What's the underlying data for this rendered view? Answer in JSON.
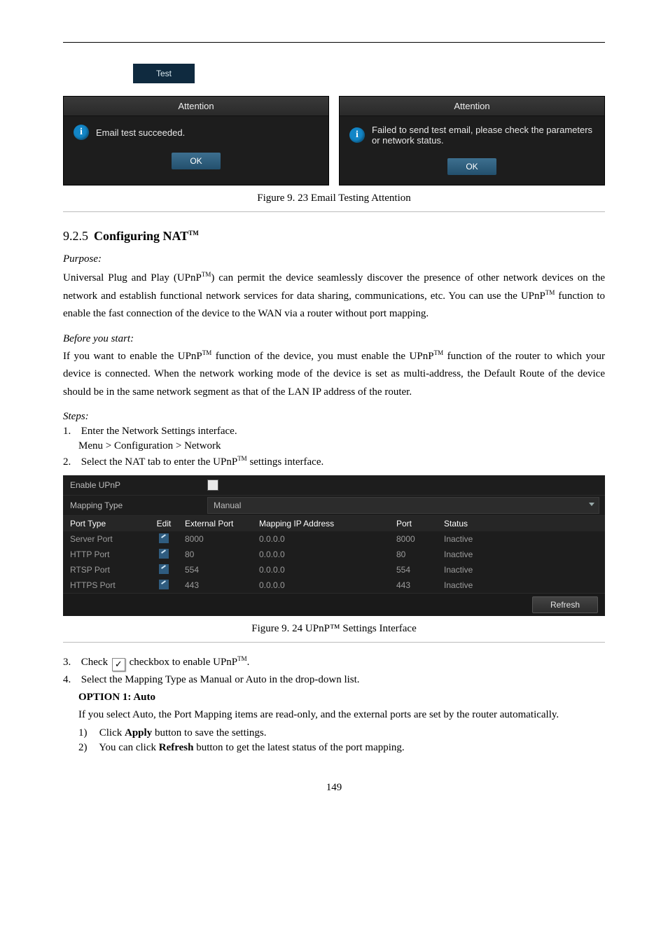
{
  "test_button": "Test",
  "dialog1": {
    "title": "Attention",
    "msg": "Email test succeeded.",
    "ok": "OK"
  },
  "dialog2": {
    "title": "Attention",
    "msg": "Failed to send test email, please check the parameters or network status.",
    "ok": "OK"
  },
  "figure23": "Figure 9. 23  Email Testing Attention",
  "heading": {
    "num": "9.2.5",
    "title_pre": "Configuring NAT",
    "tm": "TM"
  },
  "purpose_label": "Purpose:",
  "purpose_text_1": "Universal Plug and Play (UPnP",
  "purpose_text_2": ") can permit the device seamlessly discover the presence of other network devices on the network and establish functional network services for data sharing, communications, etc. You can use the UPnP",
  "purpose_text_3": " function to enable the fast connection of the device to the WAN via a router without port mapping.",
  "before_label": "Before you start:",
  "before_text_1": "If you want to enable the UPnP",
  "before_text_2": " function of the device, you must enable the UPnP",
  "before_text_3": " function of the router to which your device is connected. When the network working mode of the device is set as multi-address, the Default Route of the device should be in the same network segment as that of the LAN IP address of the router.",
  "steps_label": "Steps:",
  "step1_a": "1.",
  "step1_b": "Enter the Network Settings interface.",
  "step1_c": "Menu > Configuration > Network",
  "step2_a": "2.",
  "step2_b_1": "Select the NAT tab to enter the UPnP",
  "step2_b_2": " settings interface.",
  "upnp": {
    "enable_label": "Enable UPnP",
    "mapping_label": "Mapping Type",
    "mapping_value": "Manual",
    "headers": {
      "c1": "Port Type",
      "c2": "Edit",
      "c3": "External Port",
      "c4": "Mapping IP Address",
      "c5": "Port",
      "c6": "Status"
    },
    "rows": [
      {
        "c1": "Server Port",
        "c3": "8000",
        "c4": "0.0.0.0",
        "c5": "8000",
        "c6": "Inactive"
      },
      {
        "c1": "HTTP Port",
        "c3": "80",
        "c4": "0.0.0.0",
        "c5": "80",
        "c6": "Inactive"
      },
      {
        "c1": "RTSP Port",
        "c3": "554",
        "c4": "0.0.0.0",
        "c5": "554",
        "c6": "Inactive"
      },
      {
        "c1": "HTTPS Port",
        "c3": "443",
        "c4": "0.0.0.0",
        "c5": "443",
        "c6": "Inactive"
      }
    ],
    "refresh": "Refresh"
  },
  "figure24": "Figure 9. 24  UPnP™ Settings Interface",
  "step3_a": "3.",
  "step3_b": "Check",
  "step3_c": "checkbox to enable UPnP",
  "step3_d": ".",
  "check_mark": "✓",
  "step4_a": "4.",
  "step4_b": "Select the Mapping Type as Manual or Auto in the drop-down list.",
  "option1_h": "OPTION 1: Auto",
  "option1_t": "If you select Auto, the Port Mapping items are read-only, and the external ports are set by the router automatically.",
  "sub1_a": "1)",
  "sub1_b1": "Click ",
  "sub1_b_apply": "Apply",
  "sub1_b2": " button to save the settings.",
  "sub2_a": "2)",
  "sub2_b1": "You can click ",
  "sub2_b_refresh": "Refresh",
  "sub2_b2": " button to get the latest status of the port mapping.",
  "page_number": "149",
  "chart_data": {
    "type": "table",
    "title": "UPnP Port Mapping",
    "columns": [
      "Port Type",
      "Edit",
      "External Port",
      "Mapping IP Address",
      "Port",
      "Status"
    ],
    "rows": [
      [
        "Server Port",
        "edit",
        "8000",
        "0.0.0.0",
        "8000",
        "Inactive"
      ],
      [
        "HTTP Port",
        "edit",
        "80",
        "0.0.0.0",
        "80",
        "Inactive"
      ],
      [
        "RTSP Port",
        "edit",
        "554",
        "0.0.0.0",
        "554",
        "Inactive"
      ],
      [
        "HTTPS Port",
        "edit",
        "443",
        "0.0.0.0",
        "443",
        "Inactive"
      ]
    ]
  }
}
